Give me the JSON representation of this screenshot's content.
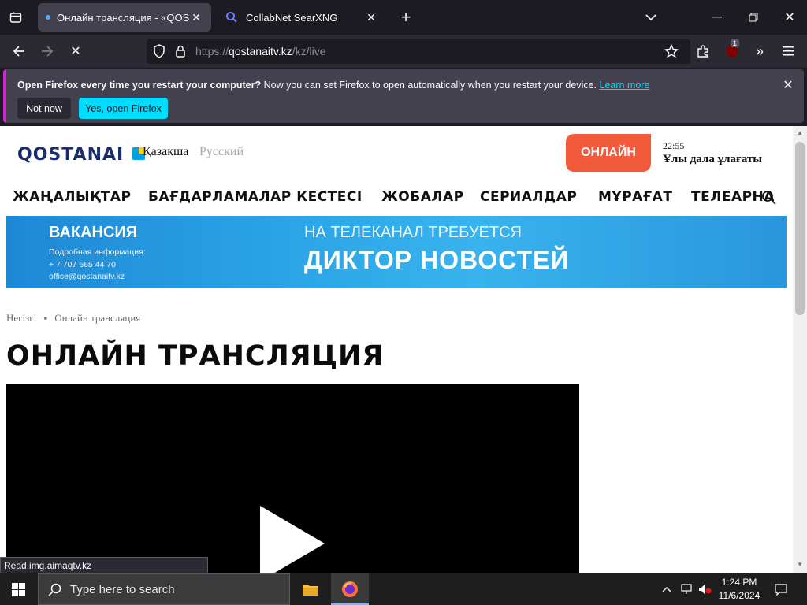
{
  "browser": {
    "tabs": [
      {
        "title": "Онлайн трансляция - «QOSTANAI»",
        "active": true
      },
      {
        "title": "CollabNet SearXNG",
        "active": false
      }
    ],
    "url_prefix": "https://",
    "url_host": "qostanaitv.kz",
    "url_path": "/kz/live",
    "extension_badge": "1"
  },
  "notification": {
    "bold": "Open Firefox every time you restart your computer?",
    "text": " Now you can set Firefox to open automatically when you restart your device.",
    "link": "Learn more",
    "not_now": "Not now",
    "yes": "Yes, open Firefox"
  },
  "site": {
    "logo": "QOSTANAI",
    "lang_kz": "Қазақша",
    "lang_ru": "Русский",
    "online_btn": "ОНЛАЙН",
    "now_time": "22:55",
    "now_show": "Ұлы дала ұлағаты",
    "menu": [
      "ЖАҢАЛЫҚТАР",
      "БАҒДАРЛАМАЛАР КЕСТЕСІ",
      "ЖОБАЛАР",
      "СЕРИАЛДАР",
      "МҰРАҒАТ",
      "ТЕЛЕАРНА"
    ],
    "banner": {
      "title": "ВАКАНСИЯ",
      "info_label": "Подробная информация:",
      "phone": "+ 7 707 665 44 70",
      "email": "office@qostanaitv.kz",
      "need": "НА ТЕЛЕКАНАЛ ТРЕБУЕТСЯ",
      "role": "ДИКТОР НОВОСТЕЙ"
    },
    "breadcrumb_home": "Негізгі",
    "breadcrumb_current": "Онлайн трансляция",
    "page_title": "ОНЛАЙН ТРАНСЛЯЦИЯ"
  },
  "status_bar": "Read img.aimaqtv.kz",
  "taskbar": {
    "search_placeholder": "Type here to search",
    "time": "1:24 PM",
    "date": "11/6/2024"
  },
  "colors": {
    "accent_orange": "#f25a3c",
    "firefox_dark": "#1c1b22",
    "link_cyan": "#00ddff"
  }
}
